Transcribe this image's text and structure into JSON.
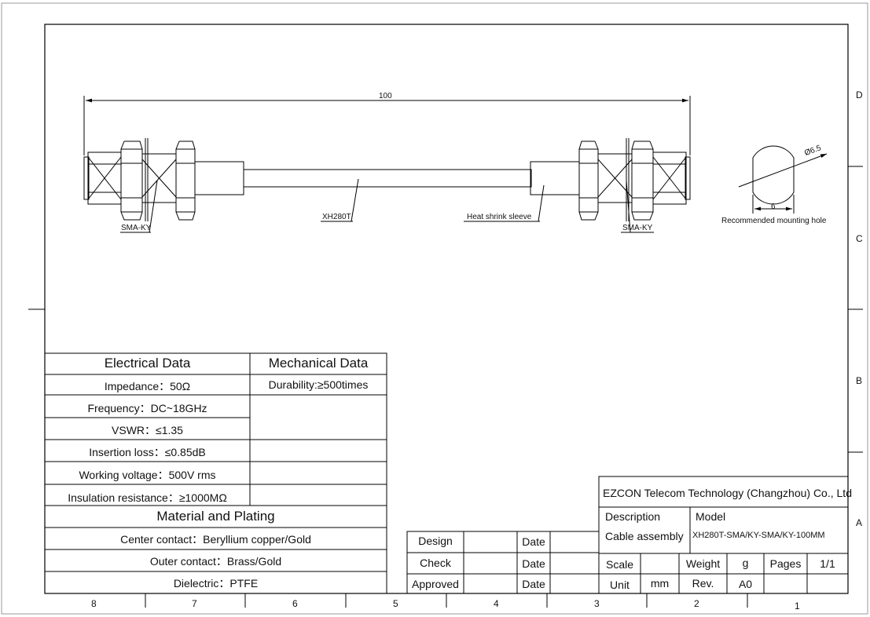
{
  "zones": {
    "columns": [
      "8",
      "7",
      "6",
      "5",
      "4",
      "3",
      "2",
      "1"
    ],
    "rows": [
      "D",
      "C",
      "B",
      "A"
    ]
  },
  "drawing": {
    "length_dim": "100",
    "left_connector": "SMA-KY",
    "right_connector": "SMA-KY",
    "cable_label": "XH280T",
    "sleeve_label": "Heat shrink sleeve",
    "hole_diameter": "Ø6.5",
    "hole_flat": "6",
    "hole_caption": "Recommended mounting hole"
  },
  "specs": {
    "electrical_title": "Electrical Data",
    "mechanical_title": "Mechanical Data",
    "impedance": "Impedance：50Ω",
    "durability": "Durability:≥500times",
    "frequency": "Frequency：DC~18GHz",
    "vswr": "VSWR：≤1.35",
    "insertion_loss": "Insertion loss：≤0.85dB",
    "working_voltage": "Working voltage：500V rms",
    "insulation": "Insulation resistance：≥1000MΩ",
    "material_title": "Material and Plating",
    "center_contact": "Center contact：Beryllium copper/Gold",
    "outer_contact": "Outer contact：Brass/Gold",
    "dielectric": "Dielectric：PTFE"
  },
  "signoff": {
    "design": "Design",
    "check": "Check",
    "approved": "Approved",
    "date1": "Date",
    "date2": "Date",
    "date3": "Date"
  },
  "title_block": {
    "company": "EZCON Telecom Technology (Changzhou) Co., Ltd",
    "description_label": "Description",
    "description_value": "Cable assembly",
    "model_label": "Model",
    "model_value": "XH280T-SMA/KY-SMA/KY-100MM",
    "scale_label": "Scale",
    "weight_label": "Weight",
    "weight_unit": "g",
    "pages_label": "Pages",
    "pages_value": "1/1",
    "unit_label": "Unit",
    "unit_value": "mm",
    "rev_label": "Rev.",
    "rev_value": "A0"
  }
}
